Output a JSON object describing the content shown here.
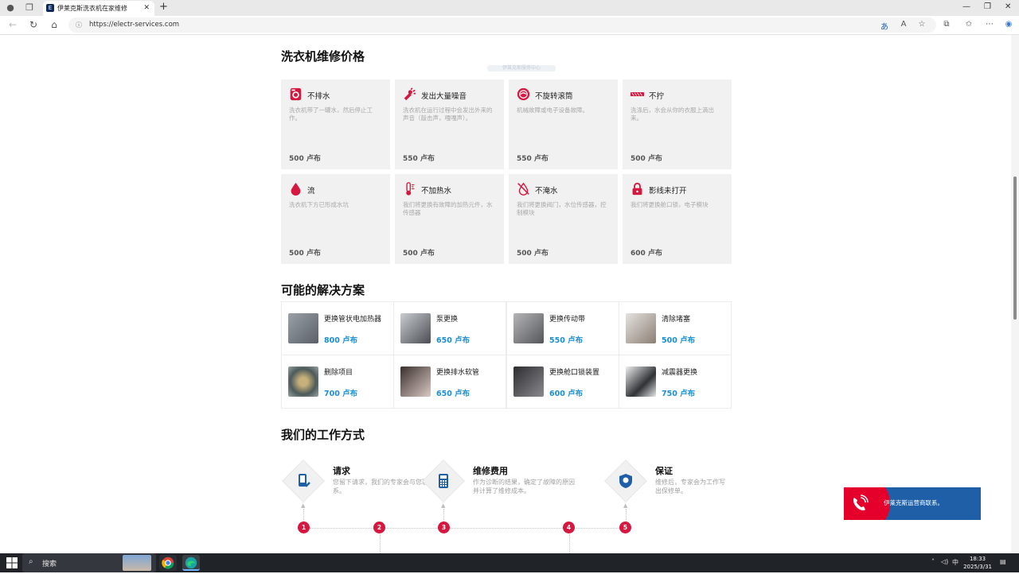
{
  "browser": {
    "tab_title": "伊莱克斯洗衣机在家维修",
    "url": "https://electr-services.com"
  },
  "faint_banner": "伊莱克斯服务中心",
  "pricing": {
    "heading": "洗衣机维修价格",
    "cards": [
      {
        "title": "不排水",
        "desc": "洗衣机带了一罐水，然后停止工作。",
        "price": "500 卢布",
        "icon": "washer-icon"
      },
      {
        "title": "发出大量噪音",
        "desc": "洗衣机在运行过程中会发出外来的声音（敲击声，嘎嘎声）。",
        "price": "550 卢布",
        "icon": "noise-icon"
      },
      {
        "title": "不旋转滚筒",
        "desc": "机械故障或电子设备故障。",
        "price": "550 卢布",
        "icon": "drum-icon"
      },
      {
        "title": "不拧",
        "desc": "洗涤后，水会从你的衣服上滴出来。",
        "price": "500 卢布",
        "icon": "wring-icon"
      },
      {
        "title": "流",
        "desc": "洗衣机下方已形成水坑",
        "price": "500 卢布",
        "icon": "drop-icon"
      },
      {
        "title": "不加热水",
        "desc": "我们将更换有故障的加热元件，水传感器",
        "price": "500 卢布",
        "icon": "thermometer-icon"
      },
      {
        "title": "不淹水",
        "desc": "我们将更换阀门，水位传感器，控制模块",
        "price": "500 卢布",
        "icon": "no-water-icon"
      },
      {
        "title": "影线未打开",
        "desc": "我们将更换舱口锁，电子模块",
        "price": "600 卢布",
        "icon": "lock-icon"
      }
    ]
  },
  "solutions": {
    "heading": "可能的解决方案",
    "items": [
      {
        "name": "更换管状电加热器",
        "price": "800 卢布",
        "color": "#7d8288"
      },
      {
        "name": "泵更换",
        "price": "650 卢布",
        "color": "#5b5f66"
      },
      {
        "name": "更换传动带",
        "price": "550 卢布",
        "color": "#6e7075"
      },
      {
        "name": "清除堵塞",
        "price": "500 卢布",
        "color": "#8c7f75"
      },
      {
        "name": "删除项目",
        "price": "700 卢布",
        "color": "#5e6a6a"
      },
      {
        "name": "更换排水软管",
        "price": "650 卢布",
        "color": "#7a6a66"
      },
      {
        "name": "更换舱口锁装置",
        "price": "600 卢布",
        "color": "#4f4f52"
      },
      {
        "name": "减震器更换",
        "price": "750 卢布",
        "color": "#3f4247"
      }
    ]
  },
  "how": {
    "heading": "我们的工作方式",
    "steps": [
      {
        "title": "请求",
        "desc": "您留下请求，我们的专家会与您联系。",
        "icon": "phone-request-icon"
      },
      {
        "title": "维修费用",
        "desc": "作为诊断的结果，确定了故障的原因并计算了维修成本。",
        "icon": "calculator-icon"
      },
      {
        "title": "保证",
        "desc": "维修后，专家会为工作写出保修单。",
        "icon": "shield-icon"
      }
    ],
    "numbers": [
      "1",
      "2",
      "3",
      "4",
      "5"
    ]
  },
  "contact": {
    "label": "伊莱克斯运营商联系。"
  },
  "taskbar": {
    "search_placeholder": "搜索",
    "ime": "中",
    "time": "18:33",
    "date": "2025/3/31"
  },
  "colors": {
    "accent_red": "#d6173f",
    "price_blue": "#1a8fd0",
    "contact_blue": "#1f5fa8"
  }
}
